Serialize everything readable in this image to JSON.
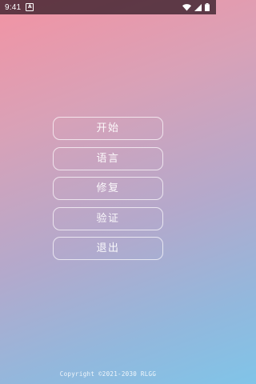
{
  "status_bar": {
    "time": "9:41",
    "notification_icon": "A",
    "icons": [
      "wifi-icon",
      "signal-icon",
      "battery-icon"
    ]
  },
  "menu": {
    "items": [
      {
        "label": "开始"
      },
      {
        "label": "语言"
      },
      {
        "label": "修复"
      },
      {
        "label": "验证"
      },
      {
        "label": "退出"
      }
    ]
  },
  "footer": {
    "copyright": "Copyright ©2021-2030 RLGG"
  },
  "colors": {
    "gradient_top": "#f393a3",
    "gradient_bottom": "#80c4e8",
    "button_border": "#ffffff",
    "status_bar": "#281420"
  }
}
